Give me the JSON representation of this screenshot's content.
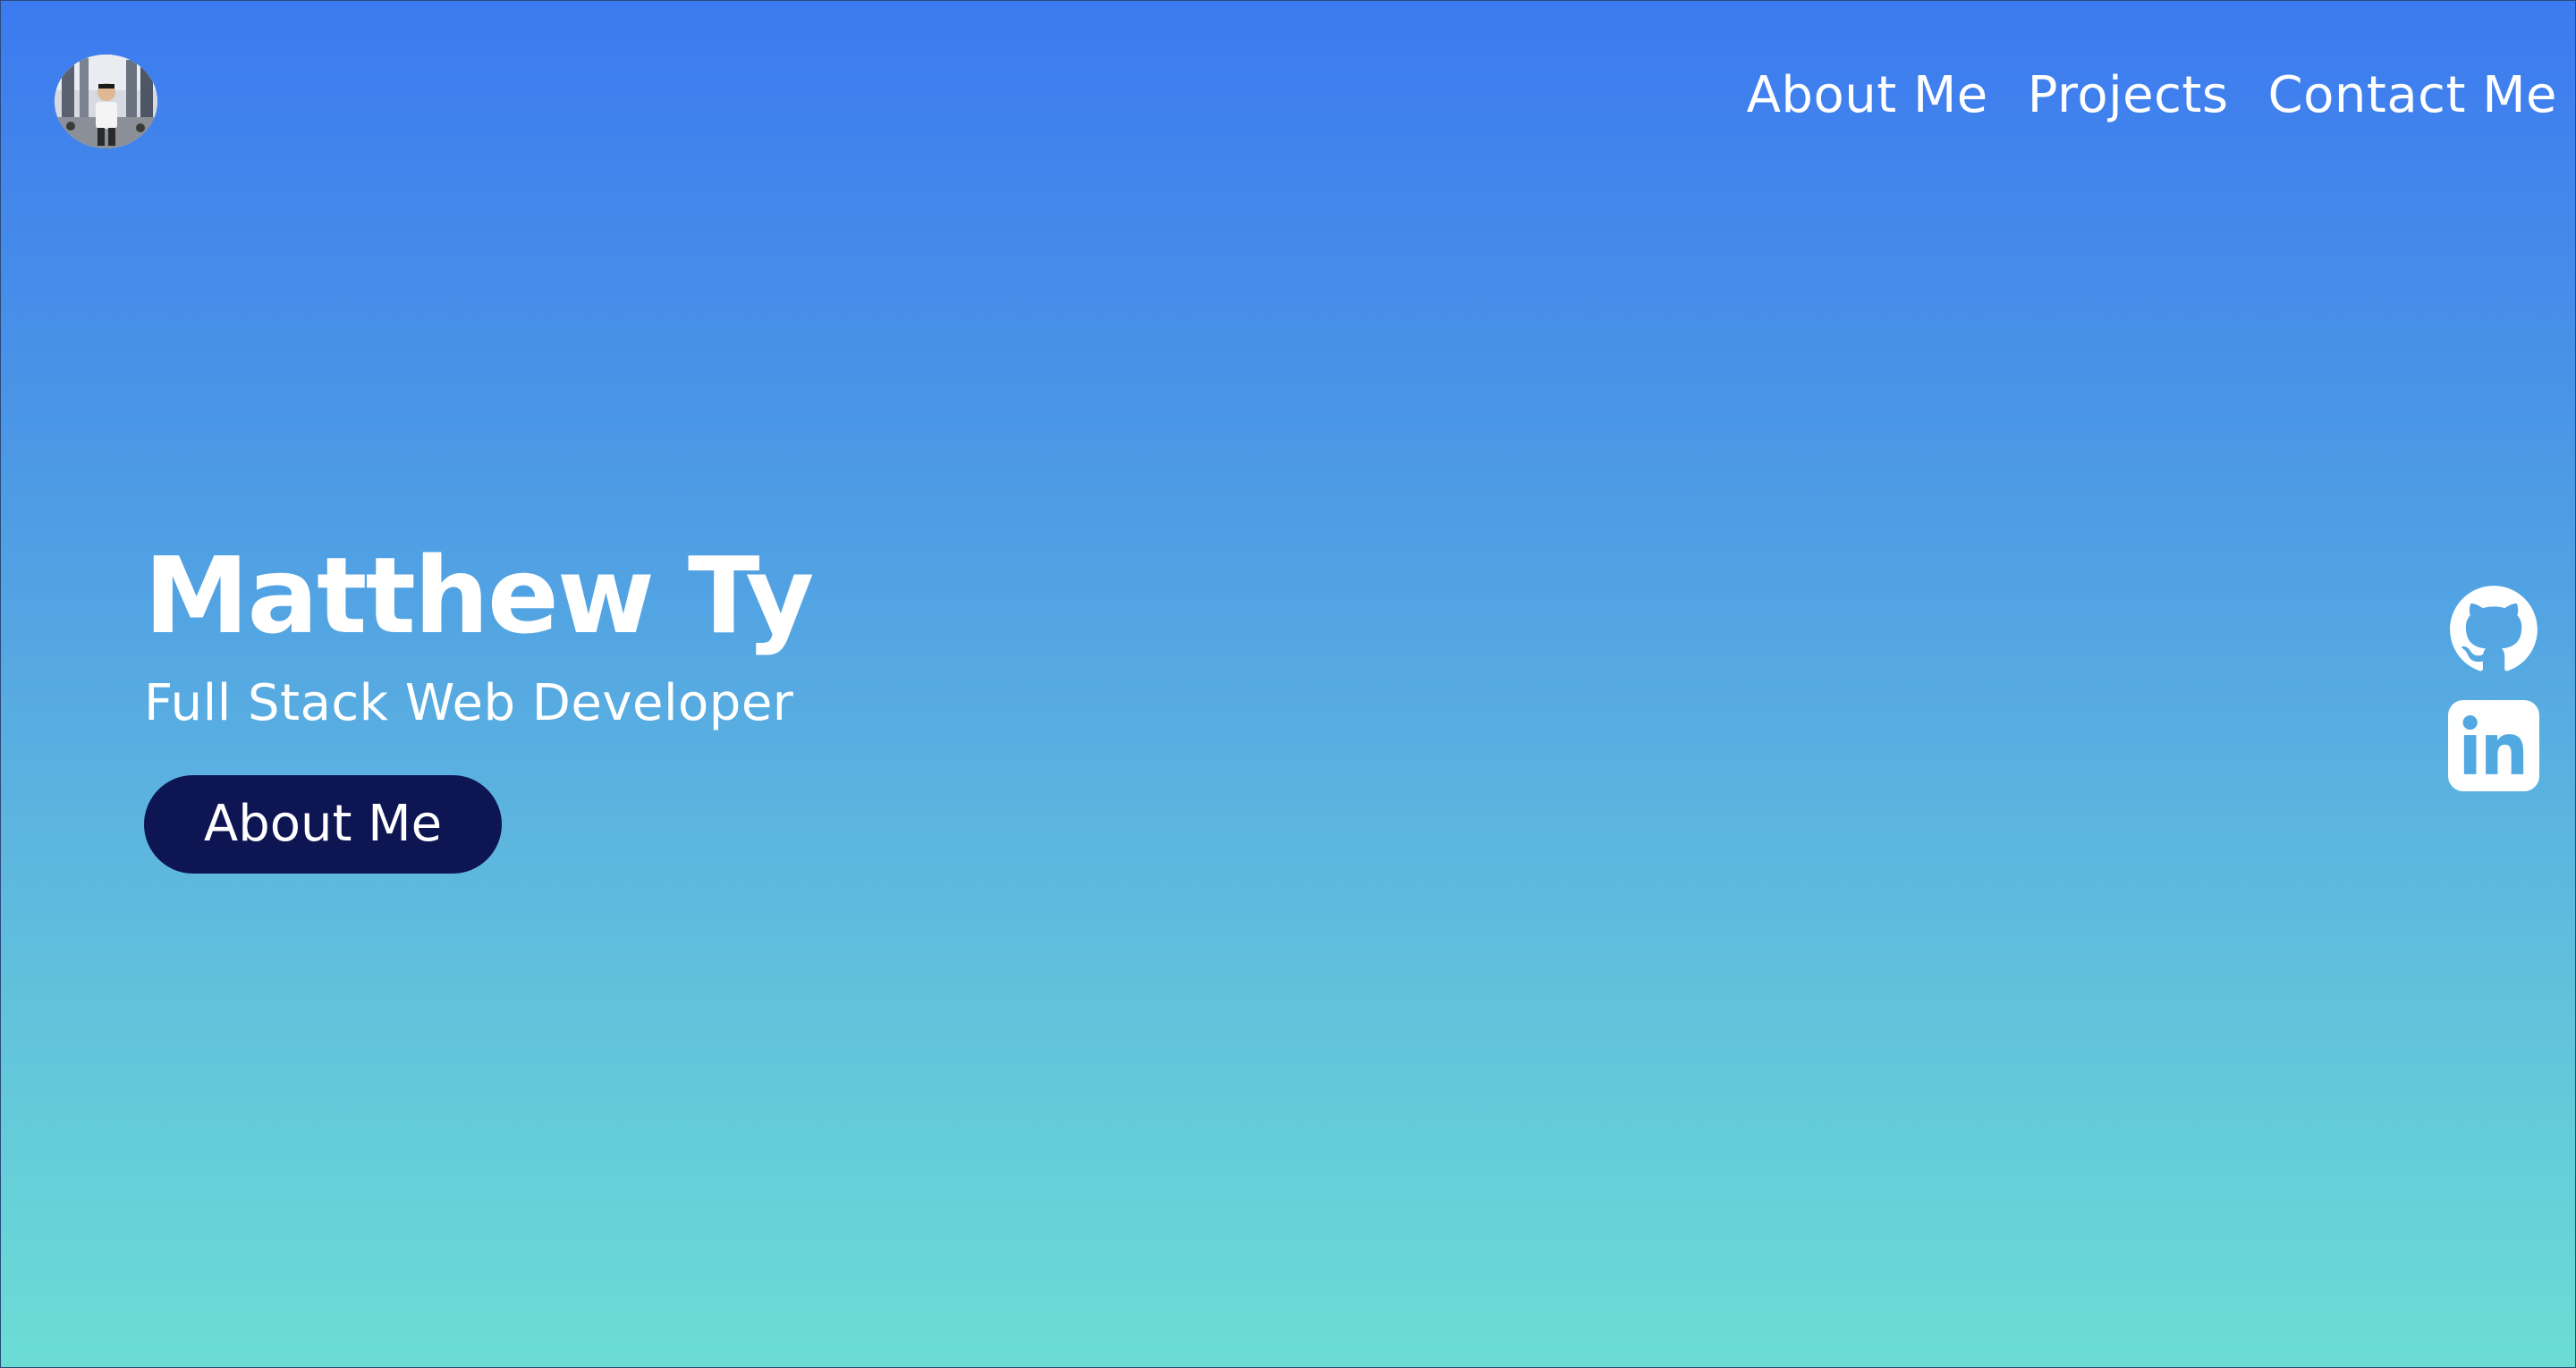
{
  "header": {
    "avatar_alt": "profile photo",
    "nav": [
      {
        "label": "About Me"
      },
      {
        "label": "Projects"
      },
      {
        "label": "Contact Me"
      }
    ]
  },
  "hero": {
    "name": "Matthew Ty",
    "subtitle": "Full Stack Web Developer",
    "button_label": "About Me"
  },
  "socials": [
    {
      "icon": "github-icon"
    },
    {
      "icon": "linkedin-icon"
    }
  ],
  "colors": {
    "gradient_top": "#3c7af0",
    "gradient_bottom": "#6bddd5",
    "button_bg": "#0e1553",
    "text": "#ffffff"
  }
}
